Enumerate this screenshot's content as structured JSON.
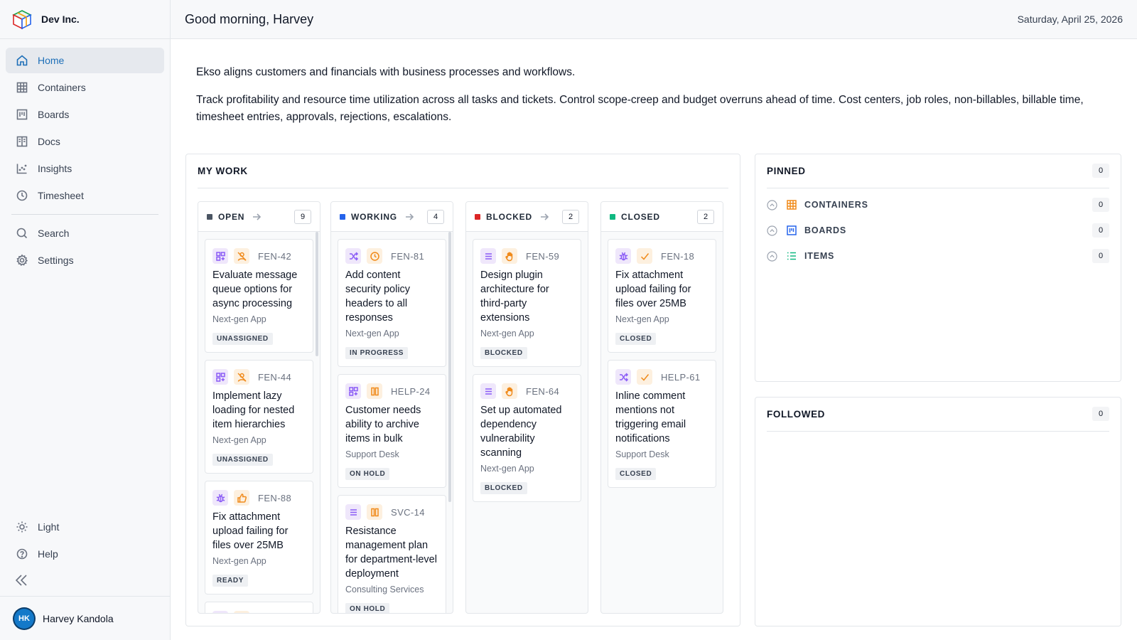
{
  "brand": {
    "name": "Dev Inc."
  },
  "nav": {
    "items": [
      {
        "label": "Home",
        "icon": "home-icon",
        "active": true
      },
      {
        "label": "Containers",
        "icon": "grid-icon"
      },
      {
        "label": "Boards",
        "icon": "board-icon"
      },
      {
        "label": "Docs",
        "icon": "docs-icon"
      },
      {
        "label": "Insights",
        "icon": "chart-icon"
      },
      {
        "label": "Timesheet",
        "icon": "clock-icon"
      }
    ],
    "secondary": [
      {
        "label": "Search",
        "icon": "search-icon"
      },
      {
        "label": "Settings",
        "icon": "gear-icon"
      }
    ],
    "bottom": [
      {
        "label": "Light",
        "icon": "sun-icon"
      },
      {
        "label": "Help",
        "icon": "help-icon"
      }
    ]
  },
  "user": {
    "initials": "HK",
    "name": "Harvey Kandola"
  },
  "header": {
    "greeting": "Good morning, Harvey",
    "date": "Saturday, April 25, 2026"
  },
  "intro": {
    "line1": "Ekso aligns customers and financials with business processes and workflows.",
    "line2": "Track profitability and resource time utilization across all tasks and tickets. Control scope-creep and budget overruns ahead of time. Cost centers, job roles, non-billables, billable time, timesheet entries, approvals, rejections, escalations."
  },
  "my_work": {
    "title": "MY WORK",
    "columns": [
      {
        "label": "OPEN",
        "count": "9",
        "color": "#4b5563",
        "cards": [
          {
            "id": "FEN-42",
            "title": "Evaluate message queue options for async processing",
            "project": "Next-gen App",
            "status": "UNASSIGNED",
            "type_icon": "feature-icon",
            "state_icon": "unassigned-icon"
          },
          {
            "id": "FEN-44",
            "title": "Implement lazy loading for nested item hierarchies",
            "project": "Next-gen App",
            "status": "UNASSIGNED",
            "type_icon": "feature-icon",
            "state_icon": "unassigned-icon"
          },
          {
            "id": "FEN-88",
            "title": "Fix attachment upload failing for files over 25MB",
            "project": "Next-gen App",
            "status": "READY",
            "type_icon": "bug-icon",
            "state_icon": "thumbs-up-icon"
          }
        ]
      },
      {
        "label": "WORKING",
        "count": "4",
        "color": "#2563eb",
        "cards": [
          {
            "id": "FEN-81",
            "title": "Add content security policy headers to all responses",
            "project": "Next-gen App",
            "status": "IN PROGRESS",
            "type_icon": "shuffle-icon",
            "state_icon": "clock-icon"
          },
          {
            "id": "HELP-24",
            "title": "Customer needs ability to archive items in bulk",
            "project": "Support Desk",
            "status": "ON HOLD",
            "type_icon": "feature-icon",
            "state_icon": "pause-icon"
          },
          {
            "id": "SVC-14",
            "title": "Resistance management plan for department-level deployment",
            "project": "Consulting Services",
            "status": "ON HOLD",
            "type_icon": "list-icon",
            "state_icon": "pause-icon"
          }
        ]
      },
      {
        "label": "BLOCKED",
        "count": "2",
        "color": "#dc2626",
        "cards": [
          {
            "id": "FEN-59",
            "title": "Design plugin architecture for third-party extensions",
            "project": "Next-gen App",
            "status": "BLOCKED",
            "type_icon": "list-icon",
            "state_icon": "hand-icon"
          },
          {
            "id": "FEN-64",
            "title": "Set up automated dependency vulnerability scanning",
            "project": "Next-gen App",
            "status": "BLOCKED",
            "type_icon": "list-icon",
            "state_icon": "hand-icon"
          }
        ]
      },
      {
        "label": "CLOSED",
        "count": "2",
        "color": "#10b981",
        "cards": [
          {
            "id": "FEN-18",
            "title": "Fix attachment upload failing for files over 25MB",
            "project": "Next-gen App",
            "status": "CLOSED",
            "type_icon": "bug-icon",
            "state_icon": "check-icon"
          },
          {
            "id": "HELP-61",
            "title": "Inline comment mentions not triggering email notifications",
            "project": "Support Desk",
            "status": "CLOSED",
            "type_icon": "shuffle-icon",
            "state_icon": "check-icon"
          }
        ]
      }
    ]
  },
  "pinned": {
    "title": "PINNED",
    "count": "0",
    "rows": [
      {
        "label": "CONTAINERS",
        "count": "0",
        "icon": "grid-icon",
        "color": "#f08a1a"
      },
      {
        "label": "BOARDS",
        "count": "0",
        "icon": "board-icon",
        "color": "#2563eb"
      },
      {
        "label": "ITEMS",
        "count": "0",
        "icon": "list-icon",
        "color": "#10b981"
      }
    ]
  },
  "followed": {
    "title": "FOLLOWED",
    "count": "0"
  }
}
